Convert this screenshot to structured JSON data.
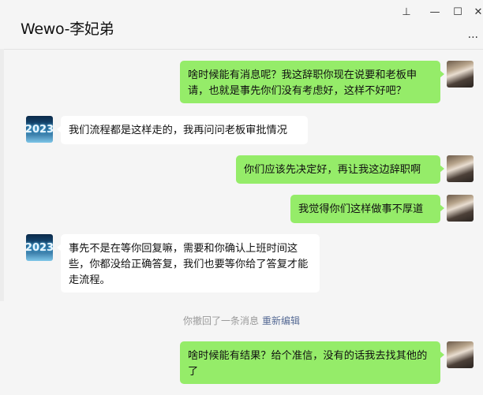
{
  "window": {
    "title": "Wewo-李妃弟",
    "controls": {
      "pin": "⊥",
      "minimize": "—",
      "maximize": "☐",
      "close": "✕",
      "more": "..."
    }
  },
  "avatars": {
    "left_text": "2023"
  },
  "messages": [
    {
      "side": "right",
      "text": "啥时候能有消息呢？我这辞职你现在说要和老板申请，也就是事先你们没有考虑好，这样不好吧？"
    },
    {
      "side": "left",
      "text": "我们流程都是这样走的，我再问问老板审批情况"
    },
    {
      "side": "right",
      "text": "你们应该先决定好，再让我这边辞职啊"
    },
    {
      "side": "right",
      "text": "我觉得你们这样做事不厚道"
    },
    {
      "side": "left",
      "text": "事先不是在等你回复嘛，需要和你确认上班时间这些，你都没给正确答复，我们也要等你给了答复才能走流程。"
    },
    {
      "side": "right",
      "text": "啥时候能有结果？给个准信，没有的话我去找其他的了"
    }
  ],
  "recall_notice": {
    "text": "你撤回了一条消息",
    "link": "重新编辑"
  },
  "colors": {
    "self_bubble": "#95ec69",
    "other_bubble": "#ffffff",
    "background": "#f5f5f5",
    "link": "#576b95"
  }
}
